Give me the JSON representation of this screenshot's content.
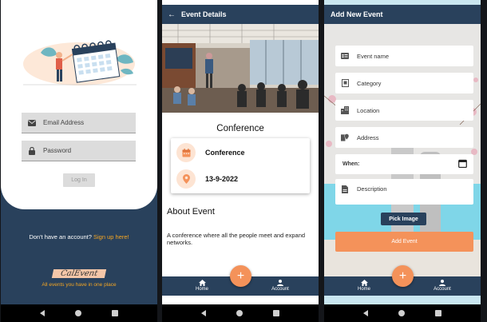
{
  "screens": {
    "login": {
      "email_placeholder": "Email Address",
      "password_placeholder": "Password",
      "login_label": "Log In",
      "signup_prompt": "Don't have an account?",
      "signup_link": "Sign up here!",
      "brand_logo": "CalEvent",
      "brand_tagline": "All events you have in one place"
    },
    "details": {
      "title": "Event Details",
      "event_title": "Conference",
      "category": "Conference",
      "date": "13-9-2022",
      "about_heading": "About Event",
      "about_text": "A conference where all the people meet and expand networks.",
      "tabs": {
        "home": "Home",
        "account": "Account"
      },
      "fab_label": "+"
    },
    "add": {
      "title": "Add New Event",
      "fields": {
        "name": "Event name",
        "category": "Category",
        "location": "Location",
        "address": "Address",
        "when": "When:",
        "description": "Description"
      },
      "pick_image": "Pick Image",
      "add_event": "Add Event",
      "tabs": {
        "home": "Home",
        "account": "Account"
      },
      "fab_label": "+"
    }
  },
  "colors": {
    "primary": "#29415c",
    "accent": "#f4925a",
    "link": "#f5a623"
  }
}
